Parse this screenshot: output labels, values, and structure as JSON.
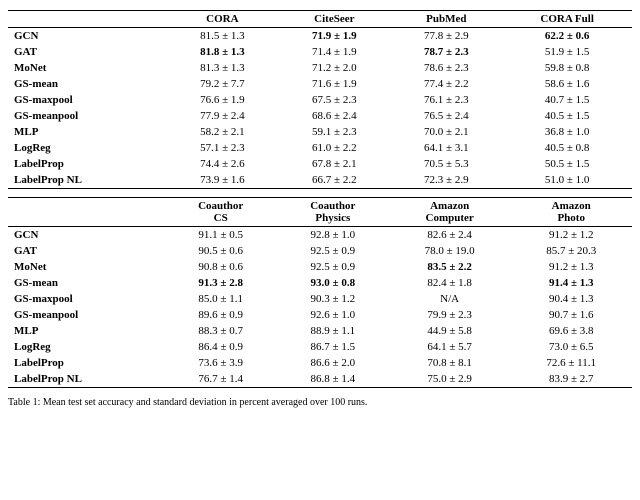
{
  "table1": {
    "headers": [
      "",
      "CORA",
      "CiteSeer",
      "PubMed",
      "CORA Full"
    ],
    "rows": [
      {
        "method": "GCN",
        "cora": "81.5 ± 1.3",
        "citeseer": "71.9 ± 1.9",
        "pubmed": "77.8 ± 2.9",
        "cora_full": "62.2 ± 0.6",
        "bold_cora": false,
        "bold_citeseer": true,
        "bold_pubmed": false,
        "bold_cora_full": true
      },
      {
        "method": "GAT",
        "cora": "81.8 ± 1.3",
        "citeseer": "71.4 ± 1.9",
        "pubmed": "78.7 ± 2.3",
        "cora_full": "51.9 ± 1.5",
        "bold_cora": true,
        "bold_citeseer": false,
        "bold_pubmed": true,
        "bold_cora_full": false
      },
      {
        "method": "MoNet",
        "cora": "81.3 ± 1.3",
        "citeseer": "71.2 ± 2.0",
        "pubmed": "78.6 ± 2.3",
        "cora_full": "59.8 ± 0.8",
        "bold_cora": false,
        "bold_citeseer": false,
        "bold_pubmed": false,
        "bold_cora_full": false
      },
      {
        "method": "GS-mean",
        "cora": "79.2 ± 7.7",
        "citeseer": "71.6 ± 1.9",
        "pubmed": "77.4 ± 2.2",
        "cora_full": "58.6 ± 1.6",
        "bold_cora": false,
        "bold_citeseer": false,
        "bold_pubmed": false,
        "bold_cora_full": false
      },
      {
        "method": "GS-maxpool",
        "cora": "76.6 ± 1.9",
        "citeseer": "67.5 ± 2.3",
        "pubmed": "76.1 ± 2.3",
        "cora_full": "40.7 ± 1.5",
        "bold_cora": false,
        "bold_citeseer": false,
        "bold_pubmed": false,
        "bold_cora_full": false
      },
      {
        "method": "GS-meanpool",
        "cora": "77.9 ± 2.4",
        "citeseer": "68.6 ± 2.4",
        "pubmed": "76.5 ± 2.4",
        "cora_full": "40.5 ± 1.5",
        "bold_cora": false,
        "bold_citeseer": false,
        "bold_pubmed": false,
        "bold_cora_full": false
      },
      {
        "method": "MLP",
        "cora": "58.2 ± 2.1",
        "citeseer": "59.1 ± 2.3",
        "pubmed": "70.0 ± 2.1",
        "cora_full": "36.8 ± 1.0",
        "bold_cora": false,
        "bold_citeseer": false,
        "bold_pubmed": false,
        "bold_cora_full": false
      },
      {
        "method": "LogReg",
        "cora": "57.1 ± 2.3",
        "citeseer": "61.0 ± 2.2",
        "pubmed": "64.1 ± 3.1",
        "cora_full": "40.5 ± 0.8",
        "bold_cora": false,
        "bold_citeseer": false,
        "bold_pubmed": false,
        "bold_cora_full": false
      },
      {
        "method": "LabelProp",
        "cora": "74.4 ± 2.6",
        "citeseer": "67.8 ± 2.1",
        "pubmed": "70.5 ± 5.3",
        "cora_full": "50.5 ± 1.5",
        "bold_cora": false,
        "bold_citeseer": false,
        "bold_pubmed": false,
        "bold_cora_full": false
      },
      {
        "method": "LabelProp NL",
        "cora": "73.9 ± 1.6",
        "citeseer": "66.7 ± 2.2",
        "pubmed": "72.3 ± 2.9",
        "cora_full": "51.0 ± 1.0",
        "bold_cora": false,
        "bold_citeseer": false,
        "bold_pubmed": false,
        "bold_cora_full": false
      }
    ]
  },
  "table2": {
    "headers": [
      "",
      "Coauthor CS",
      "Coauthor Physics",
      "Amazon Computer",
      "Amazon Photo"
    ],
    "rows": [
      {
        "method": "GCN",
        "cs": "91.1 ± 0.5",
        "phys": "92.8 ± 1.0",
        "amz_comp": "82.6 ± 2.4",
        "amz_photo": "91.2 ± 1.2",
        "bold_cs": false,
        "bold_phys": false,
        "bold_amz_comp": false,
        "bold_amz_photo": false
      },
      {
        "method": "GAT",
        "cs": "90.5 ± 0.6",
        "phys": "92.5 ± 0.9",
        "amz_comp": "78.0 ± 19.0",
        "amz_photo": "85.7 ± 20.3",
        "bold_cs": false,
        "bold_phys": false,
        "bold_amz_comp": false,
        "bold_amz_photo": false
      },
      {
        "method": "MoNet",
        "cs": "90.8 ± 0.6",
        "phys": "92.5 ± 0.9",
        "amz_comp": "83.5 ± 2.2",
        "amz_photo": "91.2 ± 1.3",
        "bold_cs": false,
        "bold_phys": false,
        "bold_amz_comp": true,
        "bold_amz_photo": false
      },
      {
        "method": "GS-mean",
        "cs": "91.3 ± 2.8",
        "phys": "93.0 ± 0.8",
        "amz_comp": "82.4 ± 1.8",
        "amz_photo": "91.4 ± 1.3",
        "bold_cs": true,
        "bold_phys": true,
        "bold_amz_comp": false,
        "bold_amz_photo": true
      },
      {
        "method": "GS-maxpool",
        "cs": "85.0 ± 1.1",
        "phys": "90.3 ± 1.2",
        "amz_comp": "N/A",
        "amz_photo": "90.4 ± 1.3",
        "bold_cs": false,
        "bold_phys": false,
        "bold_amz_comp": false,
        "bold_amz_photo": false
      },
      {
        "method": "GS-meanpool",
        "cs": "89.6 ± 0.9",
        "phys": "92.6 ± 1.0",
        "amz_comp": "79.9 ± 2.3",
        "amz_photo": "90.7 ± 1.6",
        "bold_cs": false,
        "bold_phys": false,
        "bold_amz_comp": false,
        "bold_amz_photo": false
      },
      {
        "method": "MLP",
        "cs": "88.3 ± 0.7",
        "phys": "88.9 ± 1.1",
        "amz_comp": "44.9 ± 5.8",
        "amz_photo": "69.6 ± 3.8",
        "bold_cs": false,
        "bold_phys": false,
        "bold_amz_comp": false,
        "bold_amz_photo": false
      },
      {
        "method": "LogReg",
        "cs": "86.4 ± 0.9",
        "phys": "86.7 ± 1.5",
        "amz_comp": "64.1 ± 5.7",
        "amz_photo": "73.0 ± 6.5",
        "bold_cs": false,
        "bold_phys": false,
        "bold_amz_comp": false,
        "bold_amz_photo": false
      },
      {
        "method": "LabelProp",
        "cs": "73.6 ± 3.9",
        "phys": "86.6 ± 2.0",
        "amz_comp": "70.8 ± 8.1",
        "amz_photo": "72.6 ± 11.1",
        "bold_cs": false,
        "bold_phys": false,
        "bold_amz_comp": false,
        "bold_amz_photo": false
      },
      {
        "method": "LabelProp NL",
        "cs": "76.7 ± 1.4",
        "phys": "86.8 ± 1.4",
        "amz_comp": "75.0 ± 2.9",
        "amz_photo": "83.9 ± 2.7",
        "bold_cs": false,
        "bold_phys": false,
        "bold_amz_comp": false,
        "bold_amz_photo": false
      }
    ]
  },
  "caption": "Table 1: Mean test set accuracy and standard deviation in percent averaged over 100 runs."
}
